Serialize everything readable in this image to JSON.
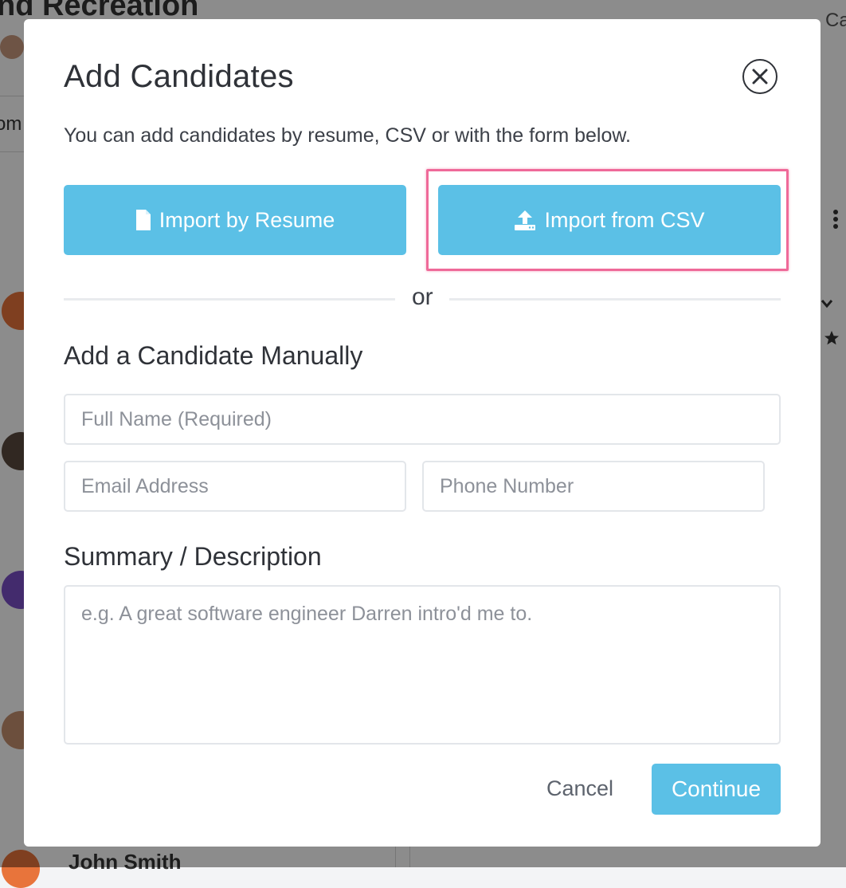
{
  "background": {
    "title_fragment": "nd Recreation",
    "top_right_fragment": "Ca",
    "left_fragment": "om",
    "candidate_name": "John Smith"
  },
  "modal": {
    "title": "Add Candidates",
    "subtitle": "You can add candidates by resume, CSV or with the form below.",
    "import_resume_label": "Import by Resume",
    "import_csv_label": "Import from CSV",
    "or_label": "or",
    "manual_title": "Add a Candidate Manually",
    "full_name_placeholder": "Full Name (Required)",
    "email_placeholder": "Email Address",
    "phone_placeholder": "Phone Number",
    "summary_title": "Summary / Description",
    "summary_placeholder": "e.g. A great software engineer Darren intro'd me to.",
    "cancel_label": "Cancel",
    "continue_label": "Continue"
  },
  "icons": {
    "close": "close-circle-icon",
    "resume": "file-icon",
    "csv": "upload-icon"
  },
  "colors": {
    "accent": "#5bc0e6",
    "highlight": "#ef6a99",
    "text_dark": "#2f3238"
  }
}
